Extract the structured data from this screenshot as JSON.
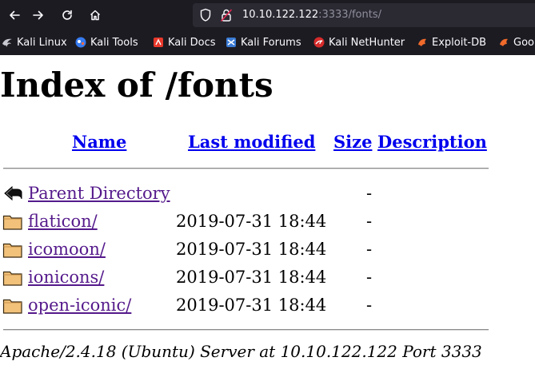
{
  "browser": {
    "url_host": "10.10.122.122",
    "url_rest": ":3333/fonts/",
    "bookmarks": [
      {
        "label": "Kali Linux",
        "icon": "kali-dragon-icon"
      },
      {
        "label": "Kali Tools",
        "icon": "kali-tools-icon"
      },
      {
        "label": "Kali Docs",
        "icon": "kali-docs-icon"
      },
      {
        "label": "Kali Forums",
        "icon": "kali-forums-icon"
      },
      {
        "label": "Kali NetHunter",
        "icon": "kali-nethunter-icon"
      },
      {
        "label": "Exploit-DB",
        "icon": "exploit-db-icon"
      },
      {
        "label": "Goo",
        "icon": "google-hacking-db-icon"
      }
    ]
  },
  "page": {
    "title": "Index of /fonts",
    "columns": {
      "name": "Name",
      "last_modified": "Last modified",
      "size": "Size",
      "description": "Description"
    },
    "parent": {
      "name": "Parent Directory",
      "last_modified": "",
      "size": "-",
      "icon": "back-arrow-icon"
    },
    "rows": [
      {
        "name": "flaticon/",
        "last_modified": "2019-07-31 18:44",
        "size": "-",
        "icon": "folder-icon"
      },
      {
        "name": "icomoon/",
        "last_modified": "2019-07-31 18:44",
        "size": "-",
        "icon": "folder-icon"
      },
      {
        "name": "ionicons/",
        "last_modified": "2019-07-31 18:44",
        "size": "-",
        "icon": "folder-icon"
      },
      {
        "name": "open-iconic/",
        "last_modified": "2019-07-31 18:44",
        "size": "-",
        "icon": "folder-icon"
      }
    ],
    "footer": "Apache/2.4.18 (Ubuntu) Server at 10.10.122.122 Port 3333"
  },
  "colors": {
    "chrome_bg": "#1c1b22",
    "urlbar_bg": "#2b2a33",
    "link": "#0000ee",
    "visited_link": "#551a8b"
  }
}
